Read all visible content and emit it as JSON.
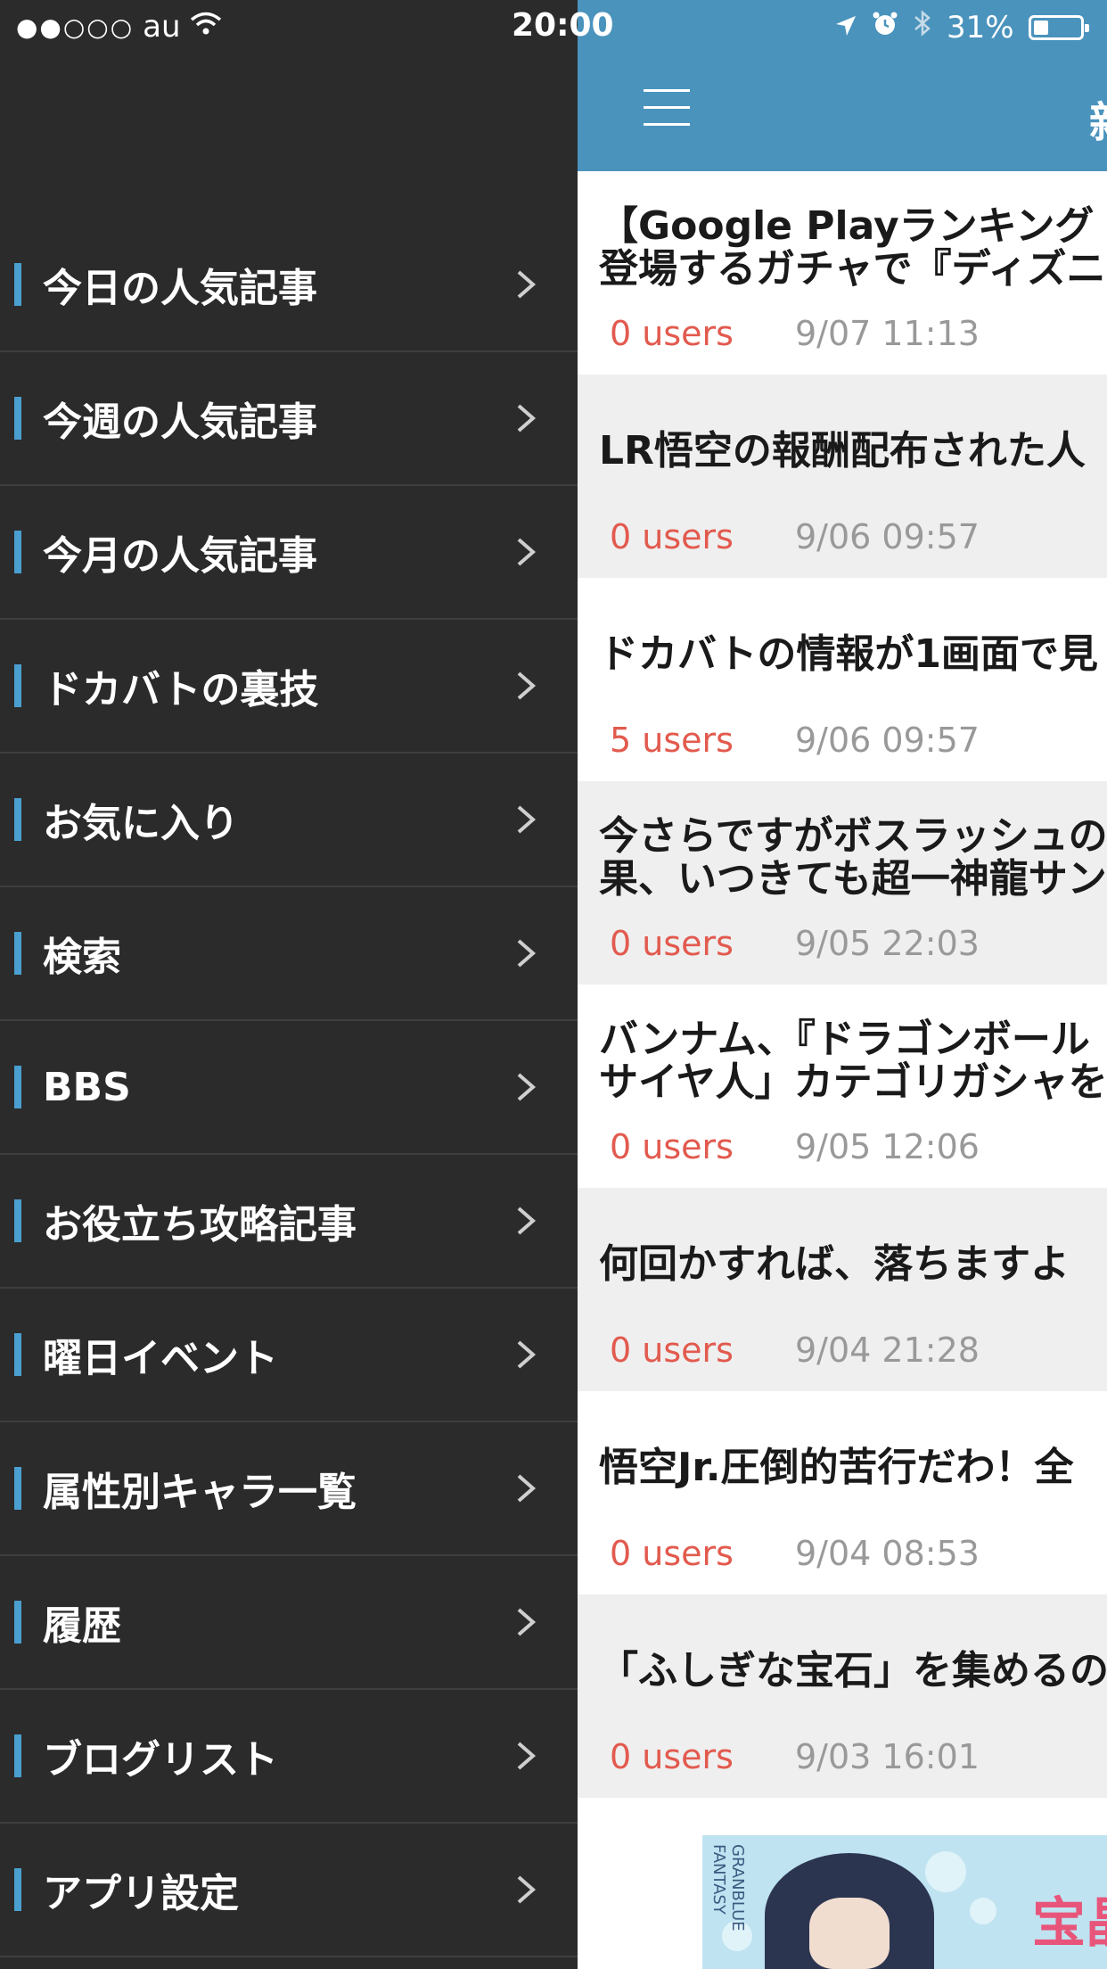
{
  "status_bar": {
    "signal_dots": "●●○○○",
    "carrier": "au",
    "time": "20:00",
    "battery": "31%",
    "battery_level": 0.31
  },
  "sidebar": {
    "items": [
      {
        "label": "今日の人気記事"
      },
      {
        "label": "今週の人気記事"
      },
      {
        "label": "今月の人気記事"
      },
      {
        "label": "ドカバトの裏技"
      },
      {
        "label": "お気に入り"
      },
      {
        "label": "検索"
      },
      {
        "label": "BBS"
      },
      {
        "label": "お役立ち攻略記事"
      },
      {
        "label": "曜日イベント"
      },
      {
        "label": "属性別キャラ一覧"
      },
      {
        "label": "履歴"
      },
      {
        "label": "ブログリスト"
      },
      {
        "label": "アプリ設定"
      }
    ]
  },
  "header": {
    "title_partial": "新"
  },
  "articles": [
    {
      "title_line1": "【Google Playランキング",
      "title_line2": "登場するガチャで『ディズニ",
      "users": "0 users",
      "date": "9/07 11:13"
    },
    {
      "title_line1": "LR悟空の報酬配布された人",
      "title_line2": "",
      "users": "0 users",
      "date": "9/06 09:57"
    },
    {
      "title_line1": "ドカバトの情報が1画面で見",
      "title_line2": "",
      "users": "5 users",
      "date": "9/06 09:57"
    },
    {
      "title_line1": "今さらですがボスラッシュの",
      "title_line2": "果、いつきても超一神龍サン",
      "users": "0 users",
      "date": "9/05 22:03"
    },
    {
      "title_line1": "バンナム、『ドラゴンボール",
      "title_line2": "サイヤ人」カテゴリガシャを",
      "users": "0 users",
      "date": "9/05 12:06"
    },
    {
      "title_line1": "何回かすれば、落ちますよ",
      "title_line2": "",
      "users": "0 users",
      "date": "9/04 21:28"
    },
    {
      "title_line1": "悟空Jr.圧倒的苦行だわ！全",
      "title_line2": "",
      "users": "0 users",
      "date": "9/04 08:53"
    },
    {
      "title_line1": "「ふしぎな宝石」を集めるの",
      "title_line2": "",
      "users": "0 users",
      "date": "9/03 16:01"
    }
  ],
  "ad": {
    "side_text": "GRANBLUE FANTASY",
    "text": "宝晶"
  }
}
